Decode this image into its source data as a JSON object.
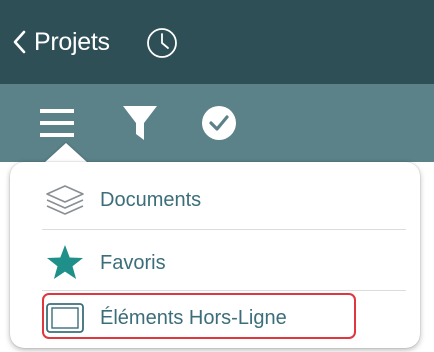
{
  "header": {
    "back_label": "Projets",
    "back_icon": "chevron-left-icon",
    "history_icon": "clock-icon"
  },
  "toolbar": {
    "icons": [
      "menu-icon",
      "filter-icon",
      "check-circle-icon"
    ]
  },
  "menu": {
    "items": [
      {
        "label": "Documents",
        "icon": "layers-icon"
      },
      {
        "label": "Favoris",
        "icon": "star-icon"
      },
      {
        "label": "Éléments Hors-Ligne",
        "icon": "offline-frame-icon"
      }
    ],
    "highlighted_index": 2
  },
  "colors": {
    "topbar": "#2f4f57",
    "toolbar": "#5b8189",
    "accent": "#3b6e7a",
    "star": "#1f8f8a",
    "highlight": "#e0363d"
  }
}
